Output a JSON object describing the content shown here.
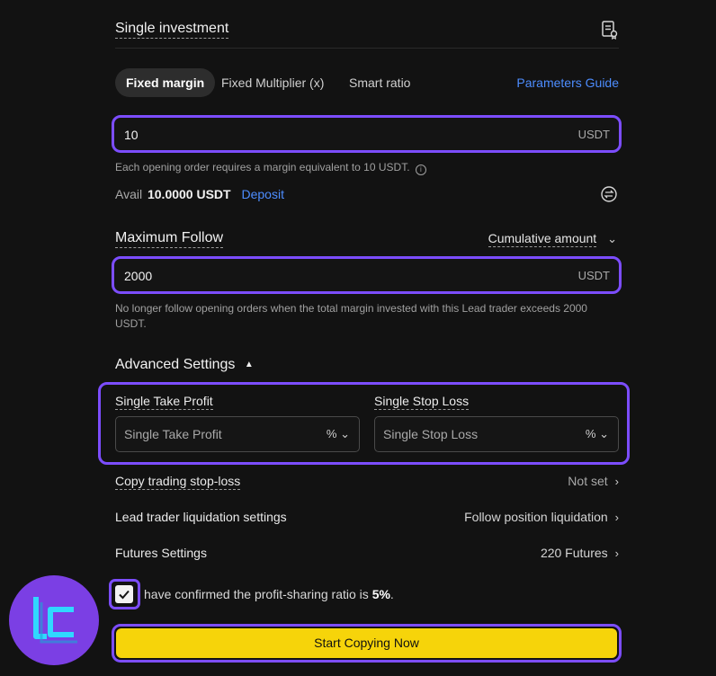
{
  "header": {
    "title": "Single investment",
    "doc_icon": "document-badge-icon"
  },
  "tabs": [
    {
      "label": "Fixed margin",
      "active": true
    },
    {
      "label": "Fixed Multiplier (x)",
      "active": false
    },
    {
      "label": "Smart ratio",
      "active": false
    }
  ],
  "params_guide": "Parameters Guide",
  "margin": {
    "value": "10",
    "unit": "USDT",
    "hint": "Each opening order requires a margin equivalent to 10 USDT."
  },
  "avail": {
    "label": "Avail",
    "amount": "10.0000 USDT",
    "deposit": "Deposit"
  },
  "max_follow": {
    "title": "Maximum Follow",
    "mode": "Cumulative amount",
    "value": "2000",
    "unit": "USDT",
    "hint": "No longer follow opening orders when the total margin invested with this Lead trader exceeds 2000 USDT."
  },
  "advanced": {
    "title": "Advanced Settings",
    "take_profit": {
      "label": "Single Take Profit",
      "placeholder": "Single Take Profit",
      "unit": "%"
    },
    "stop_loss": {
      "label": "Single Stop Loss",
      "placeholder": "Single Stop Loss",
      "unit": "%"
    }
  },
  "settings": [
    {
      "label": "Copy trading stop-loss",
      "value": "Not set",
      "dashed": true
    },
    {
      "label": "Lead trader liquidation settings",
      "value": "Follow position liquidation",
      "dashed": false
    },
    {
      "label": "Futures Settings",
      "value": "220 Futures",
      "dashed": false
    }
  ],
  "confirm": {
    "text": "have confirmed the profit-sharing ratio is",
    "ratio": "5%",
    "checked": true
  },
  "submit": "Start Copying Now",
  "colors": {
    "accent": "#7c4dff",
    "link": "#4d8dff",
    "cta": "#f6d40a"
  }
}
